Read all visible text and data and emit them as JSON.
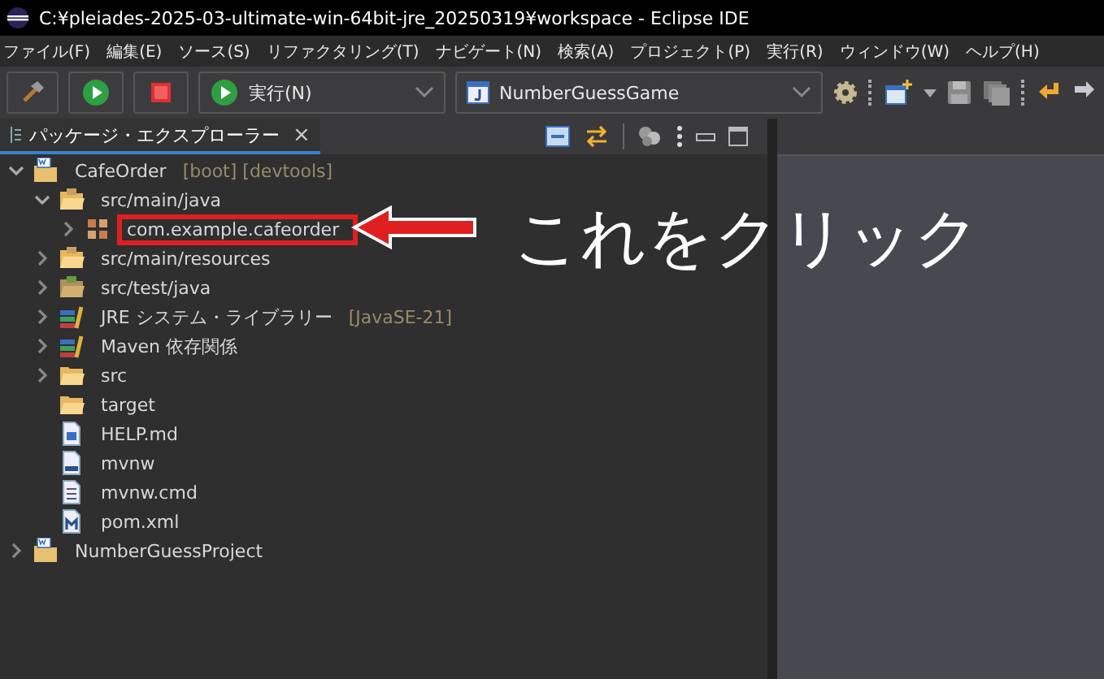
{
  "window": {
    "title": "C:¥pleiades-2025-03-ultimate-win-64bit-jre_20250319¥workspace - Eclipse IDE"
  },
  "menu": [
    "ファイル(F)",
    "編集(E)",
    "ソース(S)",
    "リファクタリング(T)",
    "ナビゲート(N)",
    "検索(A)",
    "プロジェクト(P)",
    "実行(R)",
    "ウィンドウ(W)",
    "ヘルプ(H)"
  ],
  "toolbar": {
    "run_combo": "実行(N)",
    "launch_combo": "NumberGuessGame"
  },
  "view": {
    "tab": "パッケージ・エクスプローラー",
    "close": "×"
  },
  "tree": [
    {
      "kind": "project",
      "label": "CafeOrder",
      "decoration": "[boot] [devtools]",
      "expanded": true,
      "highlighted": false,
      "children": [
        {
          "kind": "source-folder",
          "label": "src/main/java",
          "expanded": true,
          "highlighted": false,
          "children": [
            {
              "kind": "package",
              "label": "com.example.cafeorder",
              "expanded": false,
              "highlighted": true
            }
          ]
        },
        {
          "kind": "source-folder",
          "label": "src/main/resources",
          "expanded": false,
          "highlighted": false
        },
        {
          "kind": "test-folder",
          "label": "src/test/java",
          "expanded": false,
          "highlighted": false
        },
        {
          "kind": "library",
          "label": "JRE システム・ライブラリー",
          "decoration": "[JavaSE-21]",
          "expanded": false,
          "highlighted": false
        },
        {
          "kind": "library",
          "label": "Maven 依存関係",
          "expanded": false,
          "highlighted": false
        },
        {
          "kind": "folder",
          "label": "src",
          "expanded": false,
          "highlighted": false
        },
        {
          "kind": "folder",
          "label": "target",
          "highlighted": false
        },
        {
          "kind": "word-file",
          "label": "HELP.md",
          "highlighted": false
        },
        {
          "kind": "binary-file",
          "label": "mvnw",
          "highlighted": false
        },
        {
          "kind": "text-file",
          "label": "mvnw.cmd",
          "highlighted": false
        },
        {
          "kind": "maven-file",
          "label": "pom.xml",
          "highlighted": false
        }
      ]
    },
    {
      "kind": "project",
      "label": "NumberGuessProject",
      "expanded": false,
      "highlighted": false
    }
  ],
  "callout": {
    "text": "これをクリック"
  }
}
